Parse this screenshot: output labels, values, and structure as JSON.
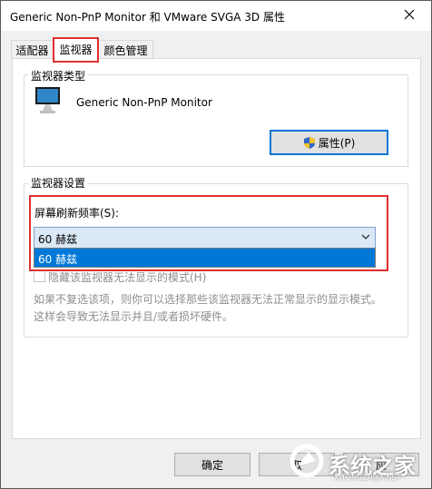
{
  "window": {
    "title": "Generic Non-PnP Monitor 和 VMware SVGA 3D 属性"
  },
  "tabs": [
    {
      "label": "适配器"
    },
    {
      "label": "监视器"
    },
    {
      "label": "颜色管理"
    }
  ],
  "monitor_type": {
    "group_label": "监视器类型",
    "name": "Generic Non-PnP Monitor",
    "properties_button": "属性(P)"
  },
  "monitor_settings": {
    "group_label": "监视器设置",
    "refresh_label": "屏幕刷新频率(S):",
    "refresh_value": "60 赫兹",
    "dropdown_option": "60 赫兹",
    "hide_modes_label": "隐藏该监视器无法显示的模式(H)",
    "description_line1": "如果不复选该项，则你可以选择那些该监视器无法正常显示的显示模式。",
    "description_line2": "这样会导致无法显示并且/或者损坏硬件。"
  },
  "buttons": {
    "ok": "确定",
    "cancel_partial": "取",
    "apply_partial": "应"
  },
  "watermark": {
    "text": "系统之家",
    "sub": "XITONGZHIJIA.NET"
  }
}
